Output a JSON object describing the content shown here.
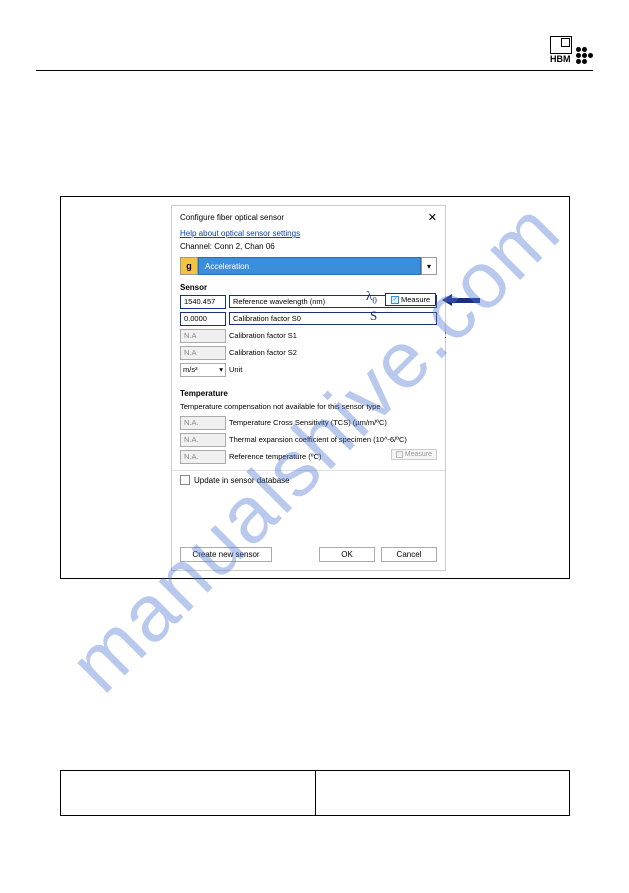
{
  "logo": {
    "text": "HBM"
  },
  "watermark": "manualshive.com",
  "dialog": {
    "title": "Configure fiber optical sensor",
    "help_link": "Help about optical sensor settings",
    "channel": "Channel: Conn 2, Chan 06",
    "dropdown_badge": "g",
    "dropdown_value": "Acceleration",
    "sensor": {
      "heading": "Sensor",
      "rows": [
        {
          "value": "1540.457",
          "label": "Reference wavelength (nm)",
          "highlight": true,
          "measure": true
        },
        {
          "value": "0.0000",
          "label": "Calibration factor S0",
          "highlight": true
        },
        {
          "value": "N.A",
          "label": "Calibration factor S1",
          "disabled": true,
          "colon": true
        },
        {
          "value": "N.A",
          "label": "Calibration factor S2",
          "disabled": true
        }
      ],
      "unit_value": "m/s²",
      "unit_label": "Unit"
    },
    "annotations": {
      "lambda": "λ",
      "lambda_sub": "0",
      "s": "S"
    },
    "measure_btn": "Measure",
    "temperature": {
      "heading": "Temperature",
      "note": "Temperature compensation not available for this sensor type",
      "rows": [
        {
          "value": "N.A.",
          "label": "Temperature Cross Sensitivity (TCS) (µm/m/ºC)"
        },
        {
          "value": "N.A.",
          "label": "Thermal expansion coefficient of specimen (10^-6/ºC)"
        },
        {
          "value": "N.A.",
          "label": "Reference temperature (ºC)",
          "measure_disabled": true
        }
      ],
      "measure_disabled_label": "Measure"
    },
    "update_checkbox": "Update in sensor database",
    "buttons": {
      "create": "Create new sensor",
      "ok": "OK",
      "cancel": "Cancel"
    }
  }
}
